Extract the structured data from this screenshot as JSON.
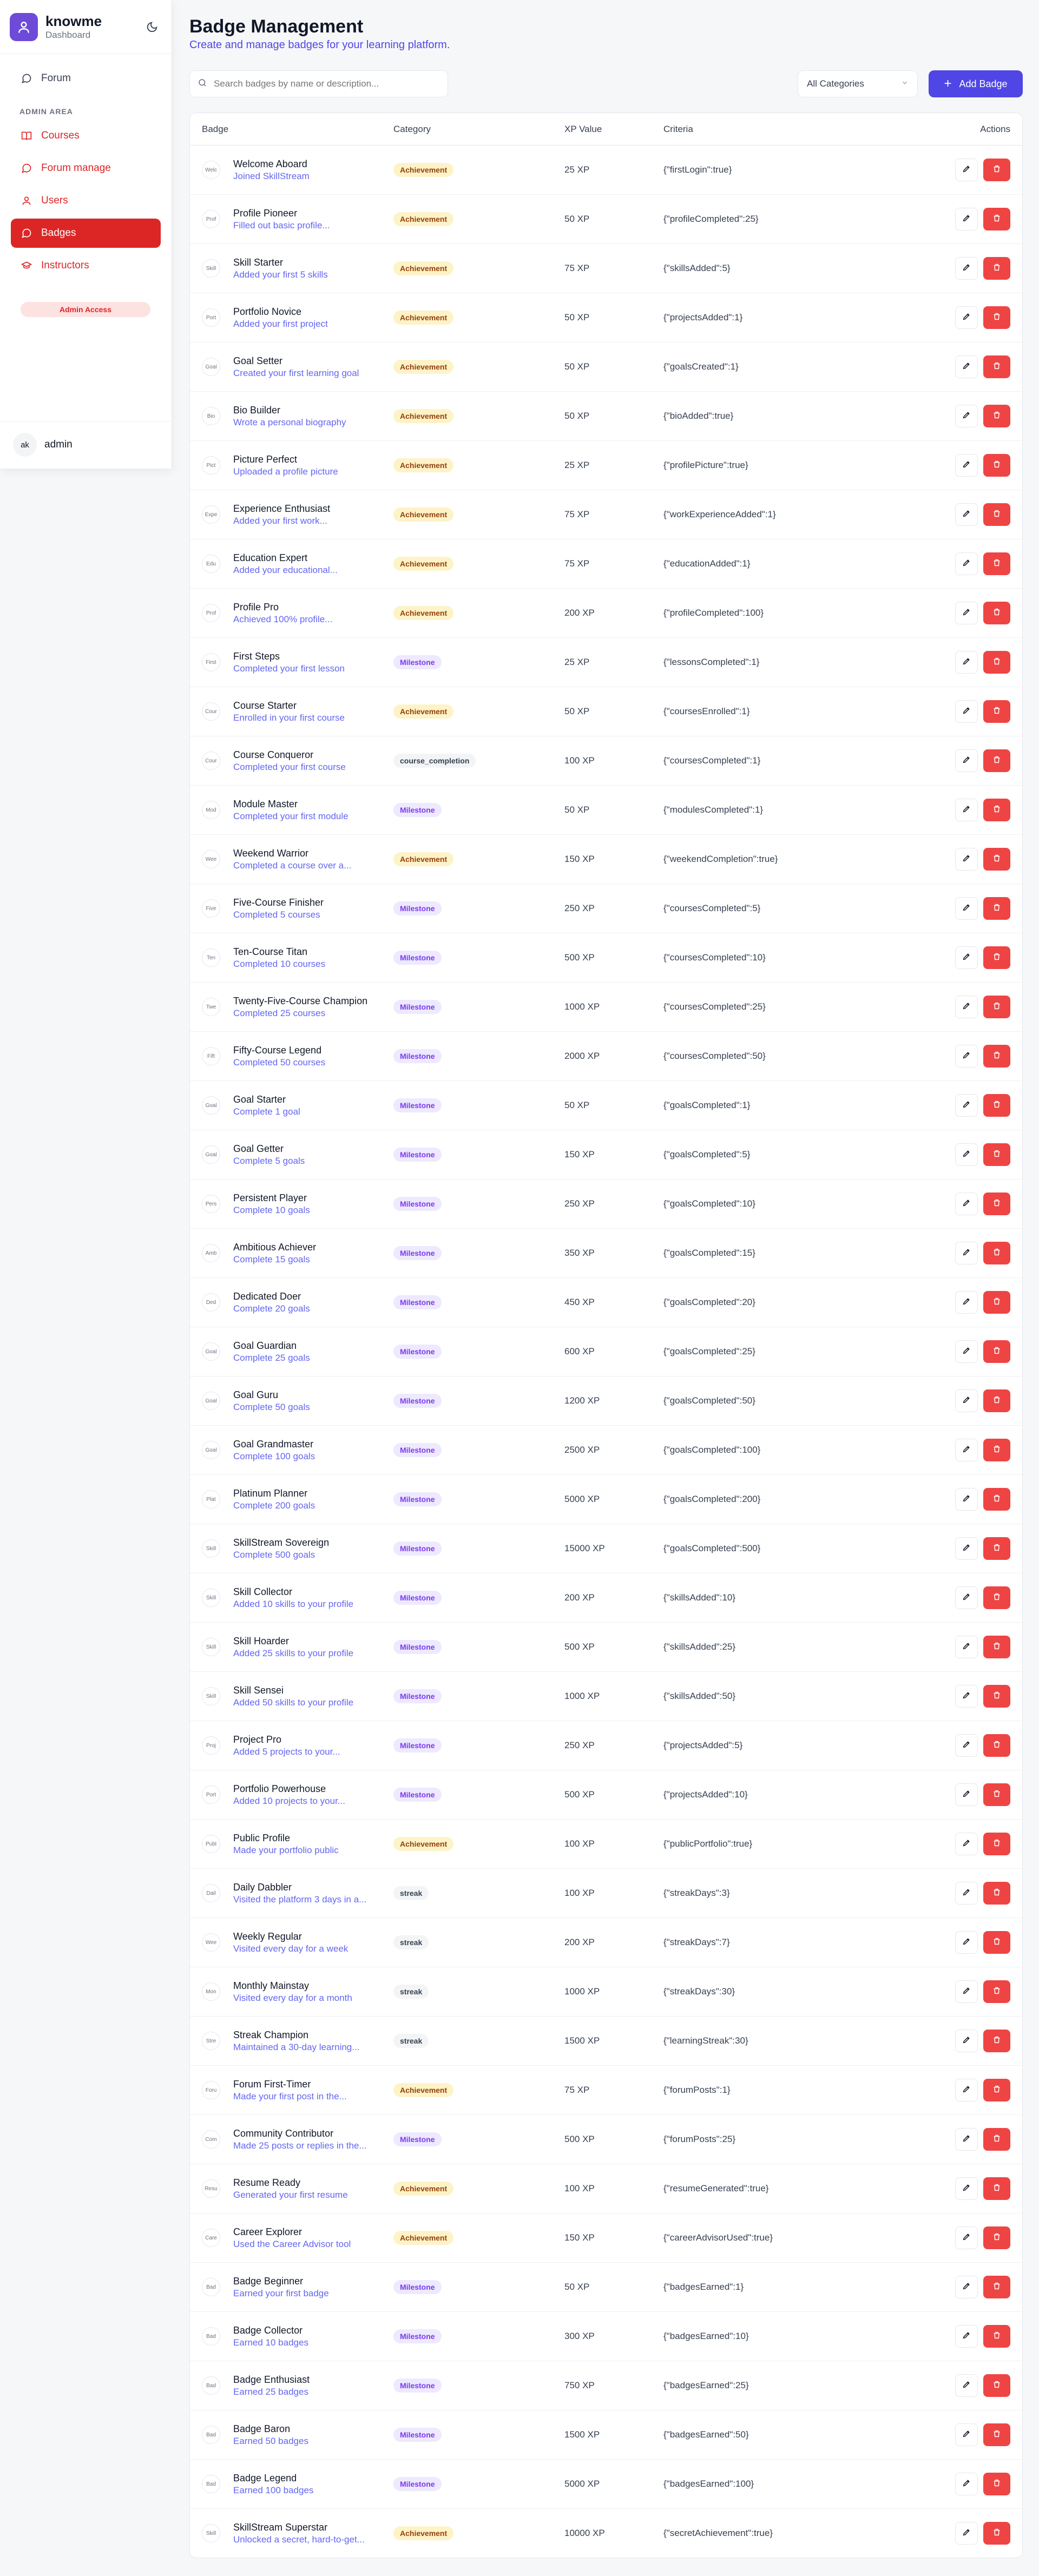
{
  "app": {
    "name": "knowme",
    "subtitle": "Dashboard"
  },
  "sidebar": {
    "items": [
      {
        "label": "Forum",
        "icon": "message-circle-icon"
      },
      {
        "label": "Courses",
        "icon": "book-open-icon"
      },
      {
        "label": "Forum manage",
        "icon": "message-circle-icon"
      },
      {
        "label": "Users",
        "icon": "user-icon"
      },
      {
        "label": "Badges",
        "icon": "message-circle-icon"
      },
      {
        "label": "Instructors",
        "icon": "graduation-cap-icon"
      }
    ],
    "section_label": "ADMIN AREA",
    "admin_badge": "Admin Access",
    "user": {
      "initials": "ak",
      "name": "admin"
    }
  },
  "page": {
    "title": "Badge Management",
    "subtitle": "Create and manage badges for your learning platform.",
    "search_placeholder": "Search badges by name or description...",
    "category_filter": "All Categories",
    "add_button": "Add Badge"
  },
  "table": {
    "headers": {
      "badge": "Badge",
      "category": "Category",
      "xp": "XP Value",
      "criteria": "Criteria",
      "actions": "Actions"
    },
    "rows": [
      {
        "name": "Welcome Aboard",
        "desc": "Joined SkillStream",
        "img": "Welc",
        "category": "Achievement",
        "xp": "25 XP",
        "criteria": "{\"firstLogin\":true}"
      },
      {
        "name": "Profile Pioneer",
        "desc": "Filled out basic profile...",
        "img": "Prof",
        "category": "Achievement",
        "xp": "50 XP",
        "criteria": "{\"profileCompleted\":25}"
      },
      {
        "name": "Skill Starter",
        "desc": "Added your first 5 skills",
        "img": "Skill",
        "category": "Achievement",
        "xp": "75 XP",
        "criteria": "{\"skillsAdded\":5}"
      },
      {
        "name": "Portfolio Novice",
        "desc": "Added your first project",
        "img": "Port",
        "category": "Achievement",
        "xp": "50 XP",
        "criteria": "{\"projectsAdded\":1}"
      },
      {
        "name": "Goal Setter",
        "desc": "Created your first learning goal",
        "img": "Goal",
        "category": "Achievement",
        "xp": "50 XP",
        "criteria": "{\"goalsCreated\":1}"
      },
      {
        "name": "Bio Builder",
        "desc": "Wrote a personal biography",
        "img": "Bio",
        "category": "Achievement",
        "xp": "50 XP",
        "criteria": "{\"bioAdded\":true}"
      },
      {
        "name": "Picture Perfect",
        "desc": "Uploaded a profile picture",
        "img": "Pict",
        "category": "Achievement",
        "xp": "25 XP",
        "criteria": "{\"profilePicture\":true}"
      },
      {
        "name": "Experience Enthusiast",
        "desc": "Added your first work...",
        "img": "Expe",
        "category": "Achievement",
        "xp": "75 XP",
        "criteria": "{\"workExperienceAdded\":1}"
      },
      {
        "name": "Education Expert",
        "desc": "Added your educational...",
        "img": "Edu",
        "category": "Achievement",
        "xp": "75 XP",
        "criteria": "{\"educationAdded\":1}"
      },
      {
        "name": "Profile Pro",
        "desc": "Achieved 100% profile...",
        "img": "Prof",
        "category": "Achievement",
        "xp": "200 XP",
        "criteria": "{\"profileCompleted\":100}"
      },
      {
        "name": "First Steps",
        "desc": "Completed your first lesson",
        "img": "First",
        "category": "Milestone",
        "xp": "25 XP",
        "criteria": "{\"lessonsCompleted\":1}"
      },
      {
        "name": "Course Starter",
        "desc": "Enrolled in your first course",
        "img": "Cour",
        "category": "Achievement",
        "xp": "50 XP",
        "criteria": "{\"coursesEnrolled\":1}"
      },
      {
        "name": "Course Conqueror",
        "desc": "Completed your first course",
        "img": "Cour",
        "category": "course_completion",
        "xp": "100 XP",
        "criteria": "{\"coursesCompleted\":1}"
      },
      {
        "name": "Module Master",
        "desc": "Completed your first module",
        "img": "Mod",
        "category": "Milestone",
        "xp": "50 XP",
        "criteria": "{\"modulesCompleted\":1}"
      },
      {
        "name": "Weekend Warrior",
        "desc": "Completed a course over a...",
        "img": "Wee",
        "category": "Achievement",
        "xp": "150 XP",
        "criteria": "{\"weekendCompletion\":true}"
      },
      {
        "name": "Five-Course Finisher",
        "desc": "Completed 5 courses",
        "img": "Five",
        "category": "Milestone",
        "xp": "250 XP",
        "criteria": "{\"coursesCompleted\":5}"
      },
      {
        "name": "Ten-Course Titan",
        "desc": "Completed 10 courses",
        "img": "Ten",
        "category": "Milestone",
        "xp": "500 XP",
        "criteria": "{\"coursesCompleted\":10}"
      },
      {
        "name": "Twenty-Five-Course Champion",
        "desc": "Completed 25 courses",
        "img": "Twe",
        "category": "Milestone",
        "xp": "1000 XP",
        "criteria": "{\"coursesCompleted\":25}"
      },
      {
        "name": "Fifty-Course Legend",
        "desc": "Completed 50 courses",
        "img": "Fift",
        "category": "Milestone",
        "xp": "2000 XP",
        "criteria": "{\"coursesCompleted\":50}"
      },
      {
        "name": "Goal Starter",
        "desc": "Complete 1 goal",
        "img": "Goal",
        "category": "Milestone",
        "xp": "50 XP",
        "criteria": "{\"goalsCompleted\":1}"
      },
      {
        "name": "Goal Getter",
        "desc": "Complete 5 goals",
        "img": "Goal",
        "category": "Milestone",
        "xp": "150 XP",
        "criteria": "{\"goalsCompleted\":5}"
      },
      {
        "name": "Persistent Player",
        "desc": "Complete 10 goals",
        "img": "Pers",
        "category": "Milestone",
        "xp": "250 XP",
        "criteria": "{\"goalsCompleted\":10}"
      },
      {
        "name": "Ambitious Achiever",
        "desc": "Complete 15 goals",
        "img": "Amb",
        "category": "Milestone",
        "xp": "350 XP",
        "criteria": "{\"goalsCompleted\":15}"
      },
      {
        "name": "Dedicated Doer",
        "desc": "Complete 20 goals",
        "img": "Ded",
        "category": "Milestone",
        "xp": "450 XP",
        "criteria": "{\"goalsCompleted\":20}"
      },
      {
        "name": "Goal Guardian",
        "desc": "Complete 25 goals",
        "img": "Goal",
        "category": "Milestone",
        "xp": "600 XP",
        "criteria": "{\"goalsCompleted\":25}"
      },
      {
        "name": "Goal Guru",
        "desc": "Complete 50 goals",
        "img": "Goal",
        "category": "Milestone",
        "xp": "1200 XP",
        "criteria": "{\"goalsCompleted\":50}"
      },
      {
        "name": "Goal Grandmaster",
        "desc": "Complete 100 goals",
        "img": "Goal",
        "category": "Milestone",
        "xp": "2500 XP",
        "criteria": "{\"goalsCompleted\":100}"
      },
      {
        "name": "Platinum Planner",
        "desc": "Complete 200 goals",
        "img": "Plat",
        "category": "Milestone",
        "xp": "5000 XP",
        "criteria": "{\"goalsCompleted\":200}"
      },
      {
        "name": "SkillStream Sovereign",
        "desc": "Complete 500 goals",
        "img": "Skill",
        "category": "Milestone",
        "xp": "15000 XP",
        "criteria": "{\"goalsCompleted\":500}"
      },
      {
        "name": "Skill Collector",
        "desc": "Added 10 skills to your profile",
        "img": "Skill",
        "category": "Milestone",
        "xp": "200 XP",
        "criteria": "{\"skillsAdded\":10}"
      },
      {
        "name": "Skill Hoarder",
        "desc": "Added 25 skills to your profile",
        "img": "Skill",
        "category": "Milestone",
        "xp": "500 XP",
        "criteria": "{\"skillsAdded\":25}"
      },
      {
        "name": "Skill Sensei",
        "desc": "Added 50 skills to your profile",
        "img": "Skill",
        "category": "Milestone",
        "xp": "1000 XP",
        "criteria": "{\"skillsAdded\":50}"
      },
      {
        "name": "Project Pro",
        "desc": "Added 5 projects to your...",
        "img": "Proj",
        "category": "Milestone",
        "xp": "250 XP",
        "criteria": "{\"projectsAdded\":5}"
      },
      {
        "name": "Portfolio Powerhouse",
        "desc": "Added 10 projects to your...",
        "img": "Port",
        "category": "Milestone",
        "xp": "500 XP",
        "criteria": "{\"projectsAdded\":10}"
      },
      {
        "name": "Public Profile",
        "desc": "Made your portfolio public",
        "img": "Publ",
        "category": "Achievement",
        "xp": "100 XP",
        "criteria": "{\"publicPortfolio\":true}"
      },
      {
        "name": "Daily Dabbler",
        "desc": "Visited the platform 3 days in a...",
        "img": "Dail",
        "category": "streak",
        "xp": "100 XP",
        "criteria": "{\"streakDays\":3}"
      },
      {
        "name": "Weekly Regular",
        "desc": "Visited every day for a week",
        "img": "Wee",
        "category": "streak",
        "xp": "200 XP",
        "criteria": "{\"streakDays\":7}"
      },
      {
        "name": "Monthly Mainstay",
        "desc": "Visited every day for a month",
        "img": "Mon",
        "category": "streak",
        "xp": "1000 XP",
        "criteria": "{\"streakDays\":30}"
      },
      {
        "name": "Streak Champion",
        "desc": "Maintained a 30-day learning...",
        "img": "Stre",
        "category": "streak",
        "xp": "1500 XP",
        "criteria": "{\"learningStreak\":30}"
      },
      {
        "name": "Forum First-Timer",
        "desc": "Made your first post in the...",
        "img": "Foru",
        "category": "Achievement",
        "xp": "75 XP",
        "criteria": "{\"forumPosts\":1}"
      },
      {
        "name": "Community Contributor",
        "desc": "Made 25 posts or replies in the...",
        "img": "Com",
        "category": "Milestone",
        "xp": "500 XP",
        "criteria": "{\"forumPosts\":25}"
      },
      {
        "name": "Resume Ready",
        "desc": "Generated your first resume",
        "img": "Resu",
        "category": "Achievement",
        "xp": "100 XP",
        "criteria": "{\"resumeGenerated\":true}"
      },
      {
        "name": "Career Explorer",
        "desc": "Used the Career Advisor tool",
        "img": "Care",
        "category": "Achievement",
        "xp": "150 XP",
        "criteria": "{\"careerAdvisorUsed\":true}"
      },
      {
        "name": "Badge Beginner",
        "desc": "Earned your first badge",
        "img": "Bad",
        "category": "Milestone",
        "xp": "50 XP",
        "criteria": "{\"badgesEarned\":1}"
      },
      {
        "name": "Badge Collector",
        "desc": "Earned 10 badges",
        "img": "Bad",
        "category": "Milestone",
        "xp": "300 XP",
        "criteria": "{\"badgesEarned\":10}"
      },
      {
        "name": "Badge Enthusiast",
        "desc": "Earned 25 badges",
        "img": "Bad",
        "category": "Milestone",
        "xp": "750 XP",
        "criteria": "{\"badgesEarned\":25}"
      },
      {
        "name": "Badge Baron",
        "desc": "Earned 50 badges",
        "img": "Bad",
        "category": "Milestone",
        "xp": "1500 XP",
        "criteria": "{\"badgesEarned\":50}"
      },
      {
        "name": "Badge Legend",
        "desc": "Earned 100 badges",
        "img": "Bad",
        "category": "Milestone",
        "xp": "5000 XP",
        "criteria": "{\"badgesEarned\":100}"
      },
      {
        "name": "SkillStream Superstar",
        "desc": "Unlocked a secret, hard-to-get...",
        "img": "Skill",
        "category": "Achievement",
        "xp": "10000 XP",
        "criteria": "{\"secretAchievement\":true}"
      }
    ]
  },
  "colors": {
    "brand": "#6d4bd8",
    "accent": "#4f46e5",
    "danger": "#dc2626"
  }
}
